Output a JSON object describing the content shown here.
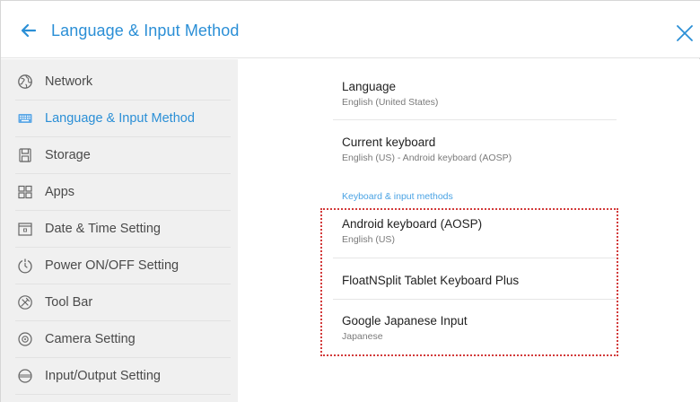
{
  "header": {
    "title": "Language & Input Method"
  },
  "sidebar": {
    "items": [
      {
        "label": "Network",
        "icon": "globe-icon",
        "active": false
      },
      {
        "label": "Language & Input Method",
        "icon": "keyboard-icon",
        "active": true
      },
      {
        "label": "Storage",
        "icon": "storage-icon",
        "active": false
      },
      {
        "label": "Apps",
        "icon": "apps-grid-icon",
        "active": false
      },
      {
        "label": "Date & Time Setting",
        "icon": "calendar-icon",
        "active": false
      },
      {
        "label": "Power ON/OFF Setting",
        "icon": "power-timer-icon",
        "active": false
      },
      {
        "label": "Tool Bar",
        "icon": "tool-bar-icon",
        "active": false
      },
      {
        "label": "Camera Setting",
        "icon": "camera-icon",
        "active": false
      },
      {
        "label": "Input/Output Setting",
        "icon": "input-output-icon",
        "active": false
      }
    ]
  },
  "content": {
    "language": {
      "title": "Language",
      "subtitle": "English (United States)"
    },
    "current_keyboard": {
      "title": "Current keyboard",
      "subtitle": "English (US) - Android keyboard (AOSP)"
    },
    "section_header": "Keyboard & input methods",
    "methods": [
      {
        "title": "Android keyboard (AOSP)",
        "subtitle": "English (US)"
      },
      {
        "title": "FloatNSplit Tablet Keyboard Plus",
        "subtitle": ""
      },
      {
        "title": "Google Japanese Input",
        "subtitle": "Japanese"
      }
    ]
  },
  "colors": {
    "accent": "#2b8fd6",
    "section_header": "#4aa3e4",
    "sidebar_bg": "#f0f0f0",
    "highlight": "#d23a3a"
  }
}
